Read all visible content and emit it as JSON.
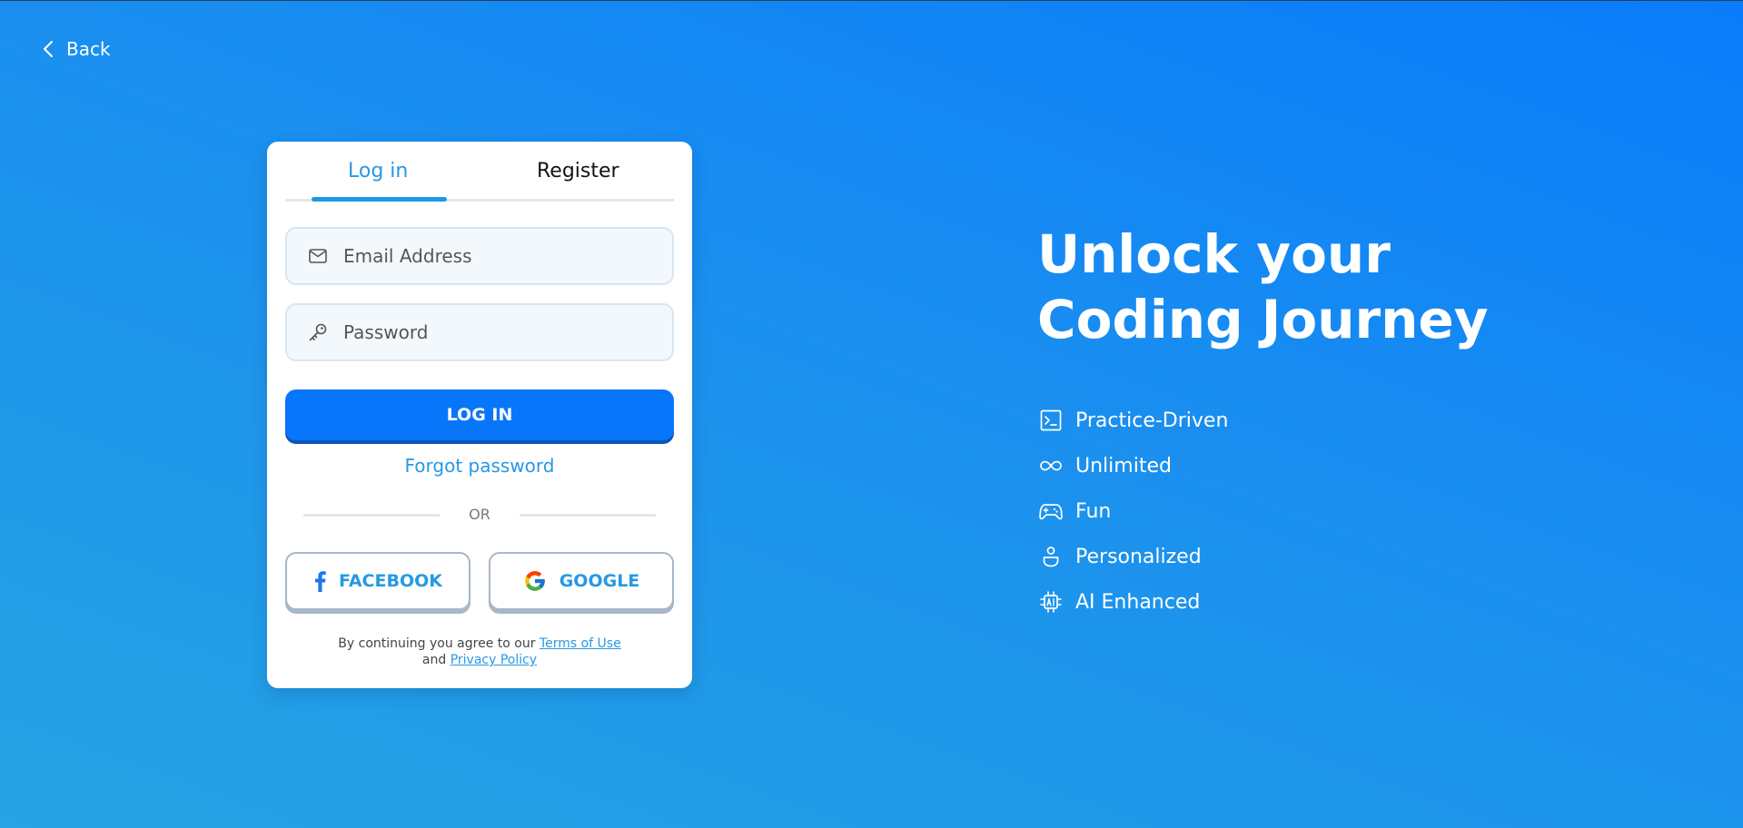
{
  "back": {
    "label": "Back"
  },
  "tabs": {
    "login": "Log in",
    "register": "Register"
  },
  "form": {
    "email_placeholder": "Email Address",
    "password_placeholder": "Password",
    "login_button": "LOG IN",
    "forgot_password": "Forgot password",
    "or": "OR",
    "facebook": "FACEBOOK",
    "google": "GOOGLE"
  },
  "legal": {
    "prefix": "By continuing you agree to our",
    "terms": "Terms of Use",
    "and": "and",
    "privacy": "Privacy Policy"
  },
  "hero": {
    "line1": "Unlock your",
    "line2": "Coding Journey"
  },
  "features": [
    {
      "label": "Practice-Driven",
      "icon": "terminal-icon"
    },
    {
      "label": "Unlimited",
      "icon": "infinity-icon"
    },
    {
      "label": "Fun",
      "icon": "gamepad-icon"
    },
    {
      "label": "Personalized",
      "icon": "person-icon"
    },
    {
      "label": "AI Enhanced",
      "icon": "ai-chip-icon"
    }
  ],
  "colors": {
    "accent": "#2699e4",
    "primary_button": "#0876fb",
    "background_top": "#0a7cfb",
    "background_bottom": "#25a3e2"
  }
}
